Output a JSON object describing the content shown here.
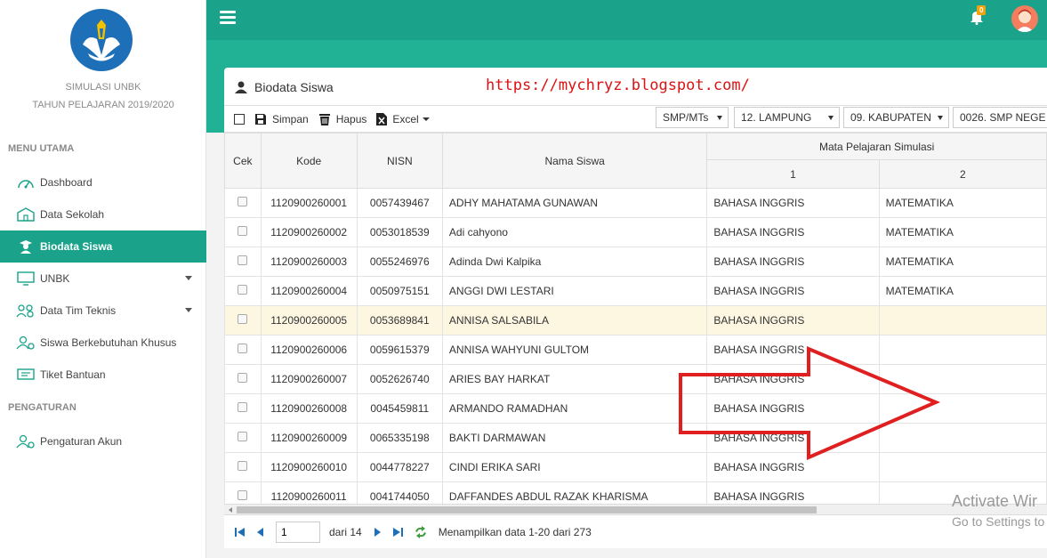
{
  "sidebar": {
    "brand_line1": "SIMULASI UNBK",
    "brand_line2": "TAHUN PELAJARAN 2019/2020",
    "section_main": "MENU UTAMA",
    "section_settings": "PENGATURAN",
    "items": [
      {
        "label": "Dashboard",
        "icon": "dashboard-icon"
      },
      {
        "label": "Data Sekolah",
        "icon": "school-icon"
      },
      {
        "label": "Biodata Siswa",
        "icon": "student-icon",
        "active": true
      },
      {
        "label": "UNBK",
        "icon": "monitor-icon"
      },
      {
        "label": "Data Tim Teknis",
        "icon": "team-icon"
      },
      {
        "label": "Siswa Berkebutuhan Khusus",
        "icon": "user-gear-icon"
      },
      {
        "label": "Tiket Bantuan",
        "icon": "ticket-icon"
      }
    ],
    "settings_items": [
      {
        "label": "Pengaturan Akun",
        "icon": "user-gear-icon"
      }
    ]
  },
  "topbar": {
    "notification_count": "0",
    "accent": "#1aa38a"
  },
  "panel": {
    "title": "Biodata Siswa",
    "url_overlay": "https://mychryz.blogspot.com/",
    "toolbar": {
      "save_label": "Simpan",
      "delete_label": "Hapus",
      "excel_label": "Excel"
    },
    "filters": {
      "level": "SMP/MTs",
      "province": "12. LAMPUNG",
      "regency": "09. KABUPATEN",
      "school": "0026. SMP NEGE"
    }
  },
  "grid": {
    "headers": {
      "cek": "Cek",
      "kode": "Kode",
      "nisn": "NISN",
      "nama": "Nama Siswa",
      "mapel": "Mata Pelajaran Simulasi",
      "mapel1": "1",
      "mapel2": "2"
    },
    "rows": [
      {
        "kode": "1120900260001",
        "nisn": "0057439467",
        "nama": "ADHY MAHATAMA GUNAWAN",
        "m1": "BAHASA INGGRIS",
        "m2": "MATEMATIKA"
      },
      {
        "kode": "1120900260002",
        "nisn": "0053018539",
        "nama": "Adi cahyono",
        "m1": "BAHASA INGGRIS",
        "m2": "MATEMATIKA"
      },
      {
        "kode": "1120900260003",
        "nisn": "0055246976",
        "nama": "Adinda Dwi Kalpika",
        "m1": "BAHASA INGGRIS",
        "m2": "MATEMATIKA"
      },
      {
        "kode": "1120900260004",
        "nisn": "0050975151",
        "nama": "ANGGI DWI LESTARI",
        "m1": "BAHASA INGGRIS",
        "m2": "MATEMATIKA"
      },
      {
        "kode": "1120900260005",
        "nisn": "0053689841",
        "nama": "ANNISA SALSABILA",
        "m1": "BAHASA INGGRIS",
        "m2": ""
      },
      {
        "kode": "1120900260006",
        "nisn": "0059615379",
        "nama": "ANNISA WAHYUNI GULTOM",
        "m1": "BAHASA INGGRIS",
        "m2": ""
      },
      {
        "kode": "1120900260007",
        "nisn": "0052626740",
        "nama": "ARIES BAY HARKAT",
        "m1": "BAHASA INGGRIS",
        "m2": ""
      },
      {
        "kode": "1120900260008",
        "nisn": "0045459811",
        "nama": "ARMANDO RAMADHAN",
        "m1": "BAHASA INGGRIS",
        "m2": ""
      },
      {
        "kode": "1120900260009",
        "nisn": "0065335198",
        "nama": "BAKTI DARMAWAN",
        "m1": "BAHASA INGGRIS",
        "m2": ""
      },
      {
        "kode": "1120900260010",
        "nisn": "0044778227",
        "nama": "CINDI ERIKA SARI",
        "m1": "BAHASA INGGRIS",
        "m2": ""
      },
      {
        "kode": "1120900260011",
        "nisn": "0041744050",
        "nama": "DAFFANDES ABDUL RAZAK KHARISMA",
        "m1": "BAHASA INGGRIS",
        "m2": ""
      }
    ],
    "highlighted_row": 4
  },
  "pager": {
    "page_value": "1",
    "of_pages": "dari 14",
    "info": "Menampilkan data 1-20 dari 273"
  },
  "os_watermark": {
    "line1": "Activate Wir",
    "line2": "Go to Settings to"
  }
}
